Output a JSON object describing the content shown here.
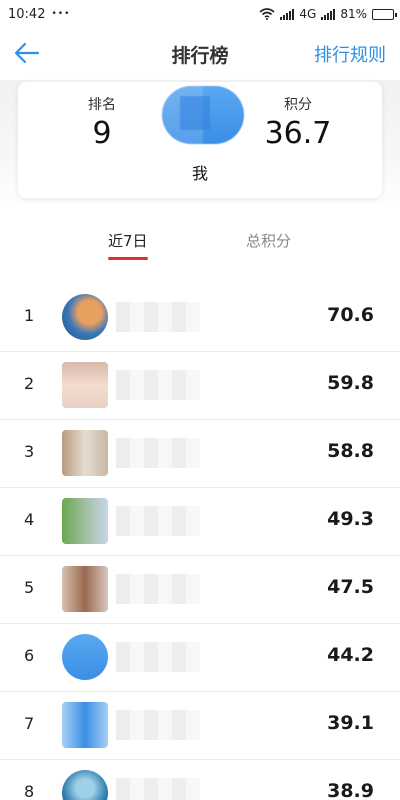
{
  "status_bar": {
    "time": "10:42",
    "dots": "•••",
    "network": "4G",
    "battery": "81%",
    "battery_level": 0.81
  },
  "nav": {
    "back_icon": "arrow-left-icon",
    "title": "排行榜",
    "rules_label": "排行规则"
  },
  "my_summary": {
    "rank_label": "排名",
    "rank_value": "9",
    "score_label": "积分",
    "score_value": "36.7",
    "name": "我"
  },
  "tabs": [
    {
      "label": "近7日",
      "active": true
    },
    {
      "label": "总积分",
      "active": false
    }
  ],
  "ranking": [
    {
      "rank": "1",
      "score": "70.6"
    },
    {
      "rank": "2",
      "score": "59.8"
    },
    {
      "rank": "3",
      "score": "58.8"
    },
    {
      "rank": "4",
      "score": "49.3"
    },
    {
      "rank": "5",
      "score": "47.5"
    },
    {
      "rank": "6",
      "score": "44.2"
    },
    {
      "rank": "7",
      "score": "39.1"
    },
    {
      "rank": "8",
      "score": "38.9"
    }
  ],
  "colors": {
    "accent": "#2f8fe8",
    "tab_indicator": "#e0312f"
  }
}
